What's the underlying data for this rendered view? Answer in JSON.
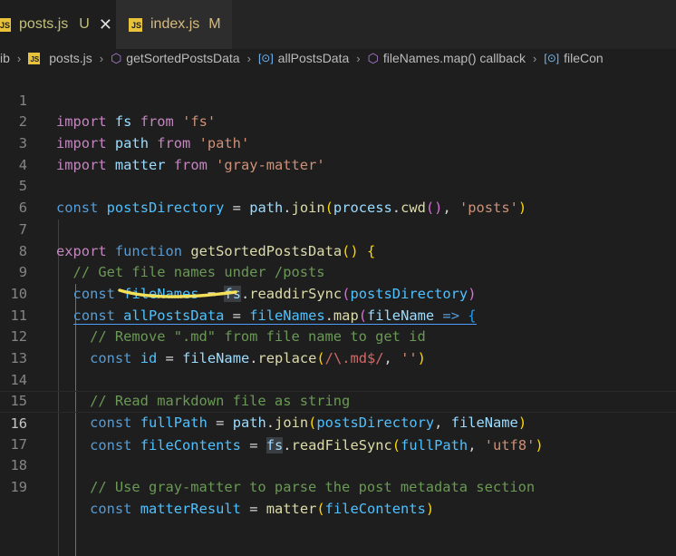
{
  "tabs": [
    {
      "icon": "JS",
      "name": "posts.js",
      "badge": "U",
      "close": "✕"
    },
    {
      "icon": "JS",
      "name": "index.js",
      "badge": "M"
    }
  ],
  "breadcrumb": {
    "prefix": "ib",
    "file": "posts.js",
    "items": [
      "getSortedPostsData",
      "allPostsData",
      "fileNames.map() callback",
      "fileCon"
    ]
  },
  "lines": [
    {
      "n": "1"
    },
    {
      "n": "2"
    },
    {
      "n": "3"
    },
    {
      "n": "4"
    },
    {
      "n": "5"
    },
    {
      "n": "6"
    },
    {
      "n": "7"
    },
    {
      "n": "8"
    },
    {
      "n": "9"
    },
    {
      "n": "10"
    },
    {
      "n": "11"
    },
    {
      "n": "12"
    },
    {
      "n": "13"
    },
    {
      "n": "14"
    },
    {
      "n": "15"
    },
    {
      "n": "16"
    },
    {
      "n": "17"
    },
    {
      "n": "18"
    },
    {
      "n": "19"
    }
  ],
  "code": {
    "l1": [
      "import",
      "fs",
      "from",
      "'fs'"
    ],
    "l2": [
      "import",
      "path",
      "from",
      "'path'"
    ],
    "l3": [
      "import",
      "matter",
      "from",
      "'gray-matter'"
    ],
    "l5": [
      "const",
      "postsDirectory",
      "=",
      "path",
      "join",
      "process",
      "cwd",
      "'posts'"
    ],
    "l7": [
      "export",
      "function",
      "getSortedPostsData",
      "{"
    ],
    "l8": "// Get file names under /posts",
    "l9": [
      "const",
      "fileNames",
      "=",
      "fs",
      "readdirSync",
      "postsDirectory"
    ],
    "l10": [
      "const",
      "allPostsData",
      "=",
      "fileNames",
      "map",
      "fileName",
      "=>",
      "{"
    ],
    "l11": "// Remove \".md\" from file name to get id",
    "l12": [
      "const",
      "id",
      "=",
      "fileName",
      "replace",
      "/\\.md$/",
      "''"
    ],
    "l14": "// Read markdown file as string",
    "l15": [
      "const",
      "fullPath",
      "=",
      "path",
      "join",
      "postsDirectory",
      "fileName"
    ],
    "l16": [
      "const",
      "fileContents",
      "=",
      "fs",
      "readFileSync",
      "fullPath",
      "'utf8'"
    ],
    "l18": "// Use gray-matter to parse the post metadata section",
    "l19": [
      "const",
      "matterResult",
      "=",
      "matter",
      "fileContents"
    ]
  },
  "colors": {
    "background": "#1e1e1e",
    "keyword": "#569cd6",
    "control_keyword": "#c586c0",
    "function": "#dcdcaa",
    "variable": "#9cdcfe",
    "string": "#ce9178",
    "comment": "#6a9955",
    "annotation_underline": "#f5e05a"
  }
}
